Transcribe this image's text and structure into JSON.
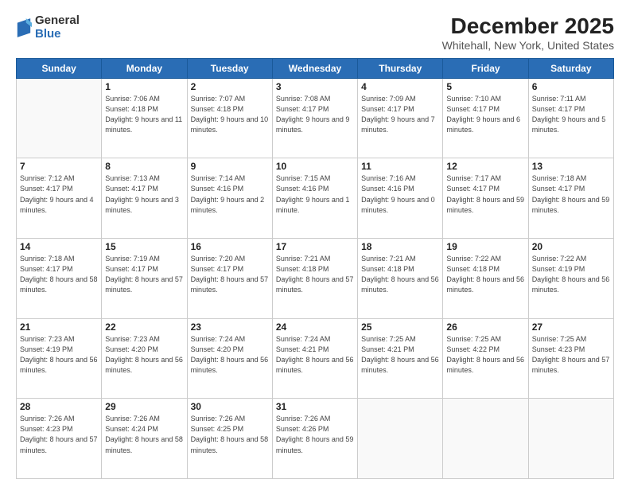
{
  "logo": {
    "general": "General",
    "blue": "Blue"
  },
  "header": {
    "title": "December 2025",
    "subtitle": "Whitehall, New York, United States"
  },
  "weekdays": [
    "Sunday",
    "Monday",
    "Tuesday",
    "Wednesday",
    "Thursday",
    "Friday",
    "Saturday"
  ],
  "weeks": [
    [
      {
        "day": "",
        "sunrise": "",
        "sunset": "",
        "daylight": ""
      },
      {
        "day": "1",
        "sunrise": "Sunrise: 7:06 AM",
        "sunset": "Sunset: 4:18 PM",
        "daylight": "Daylight: 9 hours and 11 minutes."
      },
      {
        "day": "2",
        "sunrise": "Sunrise: 7:07 AM",
        "sunset": "Sunset: 4:18 PM",
        "daylight": "Daylight: 9 hours and 10 minutes."
      },
      {
        "day": "3",
        "sunrise": "Sunrise: 7:08 AM",
        "sunset": "Sunset: 4:17 PM",
        "daylight": "Daylight: 9 hours and 9 minutes."
      },
      {
        "day": "4",
        "sunrise": "Sunrise: 7:09 AM",
        "sunset": "Sunset: 4:17 PM",
        "daylight": "Daylight: 9 hours and 7 minutes."
      },
      {
        "day": "5",
        "sunrise": "Sunrise: 7:10 AM",
        "sunset": "Sunset: 4:17 PM",
        "daylight": "Daylight: 9 hours and 6 minutes."
      },
      {
        "day": "6",
        "sunrise": "Sunrise: 7:11 AM",
        "sunset": "Sunset: 4:17 PM",
        "daylight": "Daylight: 9 hours and 5 minutes."
      }
    ],
    [
      {
        "day": "7",
        "sunrise": "Sunrise: 7:12 AM",
        "sunset": "Sunset: 4:17 PM",
        "daylight": "Daylight: 9 hours and 4 minutes."
      },
      {
        "day": "8",
        "sunrise": "Sunrise: 7:13 AM",
        "sunset": "Sunset: 4:17 PM",
        "daylight": "Daylight: 9 hours and 3 minutes."
      },
      {
        "day": "9",
        "sunrise": "Sunrise: 7:14 AM",
        "sunset": "Sunset: 4:16 PM",
        "daylight": "Daylight: 9 hours and 2 minutes."
      },
      {
        "day": "10",
        "sunrise": "Sunrise: 7:15 AM",
        "sunset": "Sunset: 4:16 PM",
        "daylight": "Daylight: 9 hours and 1 minute."
      },
      {
        "day": "11",
        "sunrise": "Sunrise: 7:16 AM",
        "sunset": "Sunset: 4:16 PM",
        "daylight": "Daylight: 9 hours and 0 minutes."
      },
      {
        "day": "12",
        "sunrise": "Sunrise: 7:17 AM",
        "sunset": "Sunset: 4:17 PM",
        "daylight": "Daylight: 8 hours and 59 minutes."
      },
      {
        "day": "13",
        "sunrise": "Sunrise: 7:18 AM",
        "sunset": "Sunset: 4:17 PM",
        "daylight": "Daylight: 8 hours and 59 minutes."
      }
    ],
    [
      {
        "day": "14",
        "sunrise": "Sunrise: 7:18 AM",
        "sunset": "Sunset: 4:17 PM",
        "daylight": "Daylight: 8 hours and 58 minutes."
      },
      {
        "day": "15",
        "sunrise": "Sunrise: 7:19 AM",
        "sunset": "Sunset: 4:17 PM",
        "daylight": "Daylight: 8 hours and 57 minutes."
      },
      {
        "day": "16",
        "sunrise": "Sunrise: 7:20 AM",
        "sunset": "Sunset: 4:17 PM",
        "daylight": "Daylight: 8 hours and 57 minutes."
      },
      {
        "day": "17",
        "sunrise": "Sunrise: 7:21 AM",
        "sunset": "Sunset: 4:18 PM",
        "daylight": "Daylight: 8 hours and 57 minutes."
      },
      {
        "day": "18",
        "sunrise": "Sunrise: 7:21 AM",
        "sunset": "Sunset: 4:18 PM",
        "daylight": "Daylight: 8 hours and 56 minutes."
      },
      {
        "day": "19",
        "sunrise": "Sunrise: 7:22 AM",
        "sunset": "Sunset: 4:18 PM",
        "daylight": "Daylight: 8 hours and 56 minutes."
      },
      {
        "day": "20",
        "sunrise": "Sunrise: 7:22 AM",
        "sunset": "Sunset: 4:19 PM",
        "daylight": "Daylight: 8 hours and 56 minutes."
      }
    ],
    [
      {
        "day": "21",
        "sunrise": "Sunrise: 7:23 AM",
        "sunset": "Sunset: 4:19 PM",
        "daylight": "Daylight: 8 hours and 56 minutes."
      },
      {
        "day": "22",
        "sunrise": "Sunrise: 7:23 AM",
        "sunset": "Sunset: 4:20 PM",
        "daylight": "Daylight: 8 hours and 56 minutes."
      },
      {
        "day": "23",
        "sunrise": "Sunrise: 7:24 AM",
        "sunset": "Sunset: 4:20 PM",
        "daylight": "Daylight: 8 hours and 56 minutes."
      },
      {
        "day": "24",
        "sunrise": "Sunrise: 7:24 AM",
        "sunset": "Sunset: 4:21 PM",
        "daylight": "Daylight: 8 hours and 56 minutes."
      },
      {
        "day": "25",
        "sunrise": "Sunrise: 7:25 AM",
        "sunset": "Sunset: 4:21 PM",
        "daylight": "Daylight: 8 hours and 56 minutes."
      },
      {
        "day": "26",
        "sunrise": "Sunrise: 7:25 AM",
        "sunset": "Sunset: 4:22 PM",
        "daylight": "Daylight: 8 hours and 56 minutes."
      },
      {
        "day": "27",
        "sunrise": "Sunrise: 7:25 AM",
        "sunset": "Sunset: 4:23 PM",
        "daylight": "Daylight: 8 hours and 57 minutes."
      }
    ],
    [
      {
        "day": "28",
        "sunrise": "Sunrise: 7:26 AM",
        "sunset": "Sunset: 4:23 PM",
        "daylight": "Daylight: 8 hours and 57 minutes."
      },
      {
        "day": "29",
        "sunrise": "Sunrise: 7:26 AM",
        "sunset": "Sunset: 4:24 PM",
        "daylight": "Daylight: 8 hours and 58 minutes."
      },
      {
        "day": "30",
        "sunrise": "Sunrise: 7:26 AM",
        "sunset": "Sunset: 4:25 PM",
        "daylight": "Daylight: 8 hours and 58 minutes."
      },
      {
        "day": "31",
        "sunrise": "Sunrise: 7:26 AM",
        "sunset": "Sunset: 4:26 PM",
        "daylight": "Daylight: 8 hours and 59 minutes."
      },
      {
        "day": "",
        "sunrise": "",
        "sunset": "",
        "daylight": ""
      },
      {
        "day": "",
        "sunrise": "",
        "sunset": "",
        "daylight": ""
      },
      {
        "day": "",
        "sunrise": "",
        "sunset": "",
        "daylight": ""
      }
    ]
  ]
}
